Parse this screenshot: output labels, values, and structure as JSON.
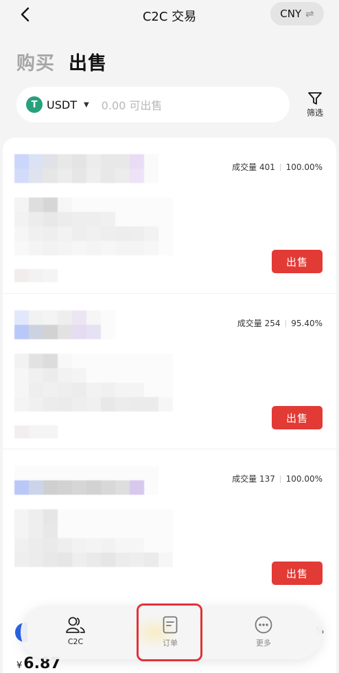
{
  "header": {
    "title": "C2C 交易",
    "currency": "CNY",
    "currency_swap_glyph": "⇌"
  },
  "tabs": [
    {
      "label": "购买",
      "active": false
    },
    {
      "label": "出售",
      "active": true
    }
  ],
  "coin_selector": {
    "icon_letter": "T",
    "coin": "USDT",
    "amount_placeholder": "0.00 可出售"
  },
  "filter": {
    "label": "筛选"
  },
  "listings": [
    {
      "volume_text": "成交量 401",
      "completion": "100.00%",
      "action_label": "出售"
    },
    {
      "volume_text": "成交量 254",
      "completion": "95.40%",
      "action_label": "出售"
    },
    {
      "volume_text": "成交量 137",
      "completion": "100.00%",
      "action_label": "出售"
    }
  ],
  "bottom": {
    "price_prefix": "¥",
    "price": "6.87",
    "edge_percent": "%"
  },
  "nav": {
    "c2c_label": "C2C",
    "order_label": "订单",
    "more_label": "更多"
  },
  "colors": {
    "accent_red": "#e23a35",
    "tether_green": "#26a17b",
    "highlight_border": "#e0323a"
  }
}
